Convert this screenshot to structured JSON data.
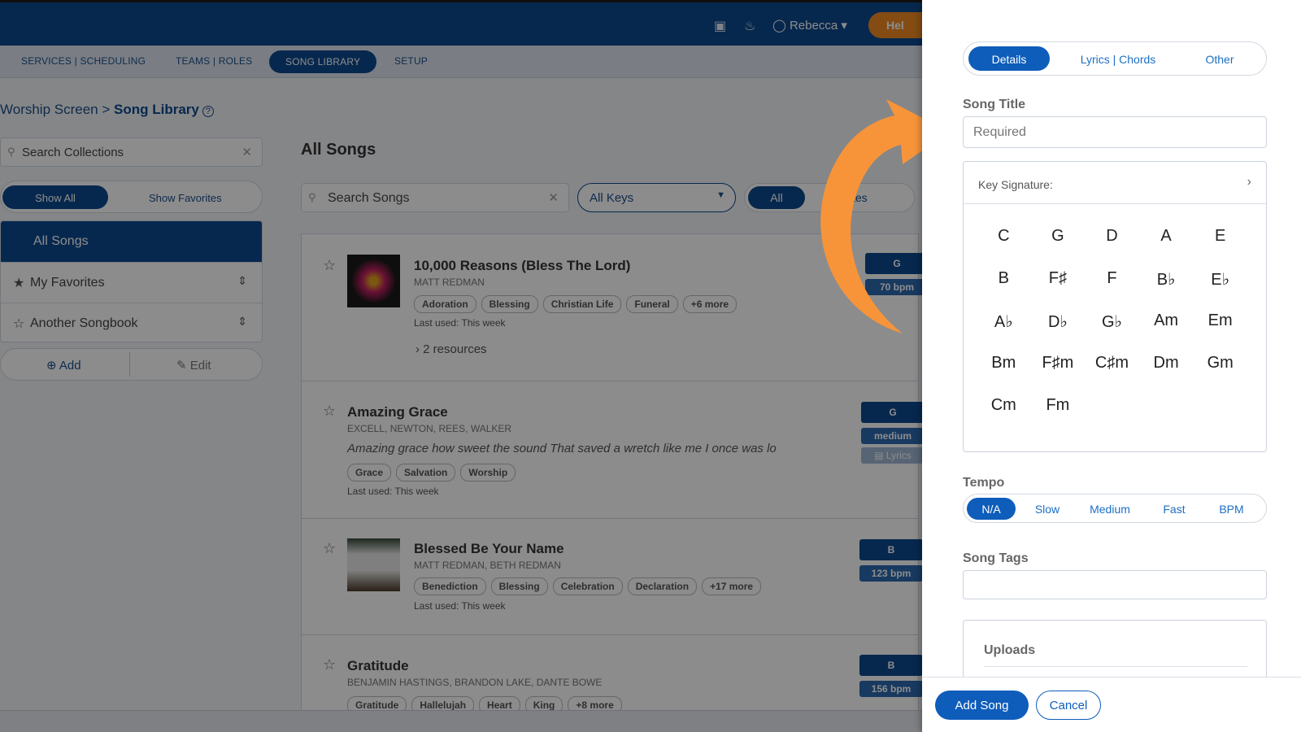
{
  "topbar": {
    "user_name": "Rebecca",
    "help_label": "Hel",
    "icons": [
      "calendar-icon",
      "bell-icon",
      "user-icon",
      "help-icon"
    ]
  },
  "nav": {
    "items": [
      "SERVICES | SCHEDULING",
      "TEAMS | ROLES",
      "SONG LIBRARY",
      "SETUP"
    ],
    "active": "SONG LIBRARY"
  },
  "breadcrumb": {
    "parent": "Worship Screen",
    "current": "Song Library"
  },
  "sidebar": {
    "search_placeholder": "Search Collections",
    "show_all": "Show All",
    "show_favorites": "Show Favorites",
    "collections": [
      "All Songs",
      "My Favorites",
      "Another Songbook"
    ],
    "add_label": "Add",
    "edit_label": "Edit"
  },
  "main": {
    "title": "All Songs",
    "search_placeholder": "Search Songs",
    "keys_filter": "All Keys",
    "filter_all": "All",
    "filter_other": "tes",
    "songs": [
      {
        "title": "10,000 Reasons (Bless The Lord)",
        "author": "MATT REDMAN",
        "tags": [
          "Adoration",
          "Blessing",
          "Christian Life",
          "Funeral",
          "+6 more"
        ],
        "last_used": "Last used: This week",
        "resources": "2 resources",
        "key": "G",
        "tempo": "70 bpm"
      },
      {
        "title": "Amazing Grace",
        "author": "EXCELL, NEWTON, REES, WALKER",
        "lyric": "Amazing grace how sweet the sound That saved a wretch like me I once was lo",
        "tags": [
          "Grace",
          "Salvation",
          "Worship"
        ],
        "last_used": "Last used: This week",
        "key": "G",
        "tempo": "medium",
        "lyrics_badge": "Lyrics"
      },
      {
        "title": "Blessed Be Your Name",
        "author": "MATT REDMAN, BETH REDMAN",
        "tags": [
          "Benediction",
          "Blessing",
          "Celebration",
          "Declaration",
          "+17 more"
        ],
        "last_used": "Last used: This week",
        "key": "B",
        "tempo": "123 bpm"
      },
      {
        "title": "Gratitude",
        "author": "BENJAMIN HASTINGS, BRANDON LAKE, DANTE BOWE",
        "tags": [
          "Gratitude",
          "Hallelujah",
          "Heart",
          "King",
          "+8 more"
        ],
        "key": "B",
        "tempo": "156 bpm"
      }
    ]
  },
  "panel": {
    "tabs": [
      "Details",
      "Lyrics | Chords",
      "Other"
    ],
    "active_tab": "Details",
    "song_title_label": "Song Title",
    "song_title_placeholder": "Required",
    "key_signature_label": "Key Signature:",
    "keys": [
      "C",
      "G",
      "D",
      "A",
      "E",
      "B",
      "F♯",
      "F",
      "B♭",
      "E♭",
      "A♭",
      "D♭",
      "G♭",
      "Am",
      "Em",
      "Bm",
      "F♯m",
      "C♯m",
      "Dm",
      "Gm",
      "Cm",
      "Fm"
    ],
    "tempo_label": "Tempo",
    "tempo_options": [
      "N/A",
      "Slow",
      "Medium",
      "Fast",
      "BPM"
    ],
    "tempo_selected": "N/A",
    "song_tags_label": "Song Tags",
    "uploads_label": "Uploads",
    "add_button": "Add Song",
    "cancel_button": "Cancel"
  },
  "colors": {
    "primary": "#0e4a8f",
    "accent_orange": "#f7943a",
    "panel_primary": "#0e5dbb"
  }
}
